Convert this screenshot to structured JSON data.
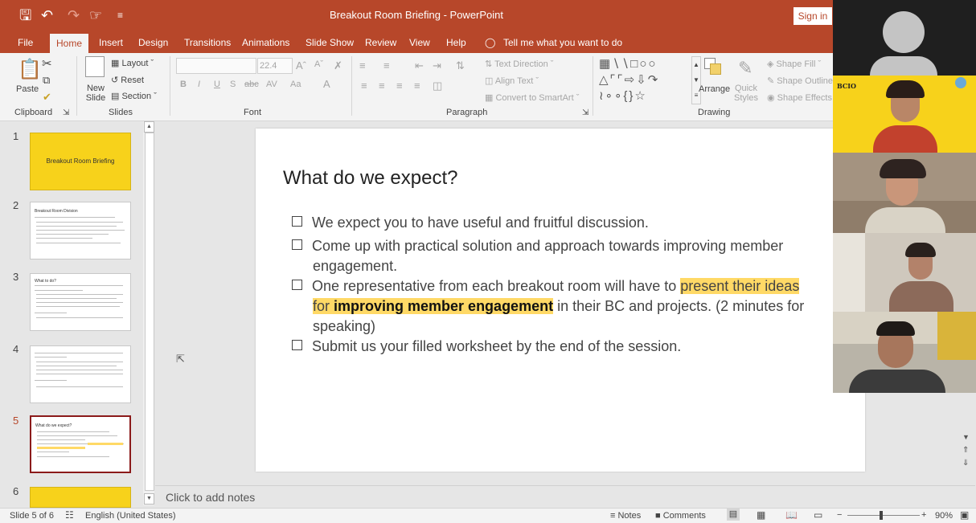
{
  "window": {
    "title": "Breakout Room Briefing - PowerPoint",
    "sign_in": "Sign in"
  },
  "tabs": [
    "File",
    "Home",
    "Insert",
    "Design",
    "Transitions",
    "Animations",
    "Slide Show",
    "Review",
    "View",
    "Help"
  ],
  "tell_me": "Tell me what you want to do",
  "ribbon": {
    "clipboard": {
      "paste": "Paste",
      "label": "Clipboard"
    },
    "slides": {
      "new_slide": "New Slide",
      "layout": "Layout",
      "reset": "Reset",
      "section": "Section",
      "label": "Slides"
    },
    "font": {
      "size": "22.4",
      "label": "Font",
      "change_case": "Aa"
    },
    "paragraph": {
      "text_direction": "Text Direction",
      "align_text": "Align Text",
      "smartart": "Convert to SmartArt",
      "label": "Paragraph"
    },
    "drawing": {
      "arrange": "Arrange",
      "quick_styles": "Quick Styles",
      "shape_fill": "Shape Fill",
      "shape_outline": "Shape Outline",
      "shape_effects": "Shape Effects",
      "label": "Drawing"
    }
  },
  "thumbnails": [
    {
      "num": "1",
      "title": "Breakout Room Briefing"
    },
    {
      "num": "2",
      "title": "Breakout Room Division"
    },
    {
      "num": "3",
      "title": "What to do?"
    },
    {
      "num": "4",
      "title": ""
    },
    {
      "num": "5",
      "title": "What do we expect?"
    },
    {
      "num": "6",
      "title": ""
    }
  ],
  "slide": {
    "title": "What do we expect?",
    "b1": "We expect you to have useful and fruitful discussion.",
    "b2a": "Come up with practical solution and approach towards improving member",
    "b2b": "engagement.",
    "b3a": "One representative from each breakout room will have to ",
    "b3hl": "present their ideas",
    "b3b_hl1": "for ",
    "b3b_bold": "improving member engagement",
    "b3b_rest": " in their BC and projects. (2 minutes for",
    "b3c": "speaking)",
    "b4": "Submit us your filled worksheet by the end of the session."
  },
  "notes_placeholder": "Click to add notes",
  "status": {
    "slide_info": "Slide 5 of 6",
    "language": "English (United States)",
    "notes": "Notes",
    "comments": "Comments",
    "zoom": "90%"
  },
  "video": {
    "logo_text": "BCIO"
  },
  "colors": {
    "accent": "#b7472a",
    "highlight": "#ffd966",
    "video_bg_yellow": "#f7d21b"
  }
}
